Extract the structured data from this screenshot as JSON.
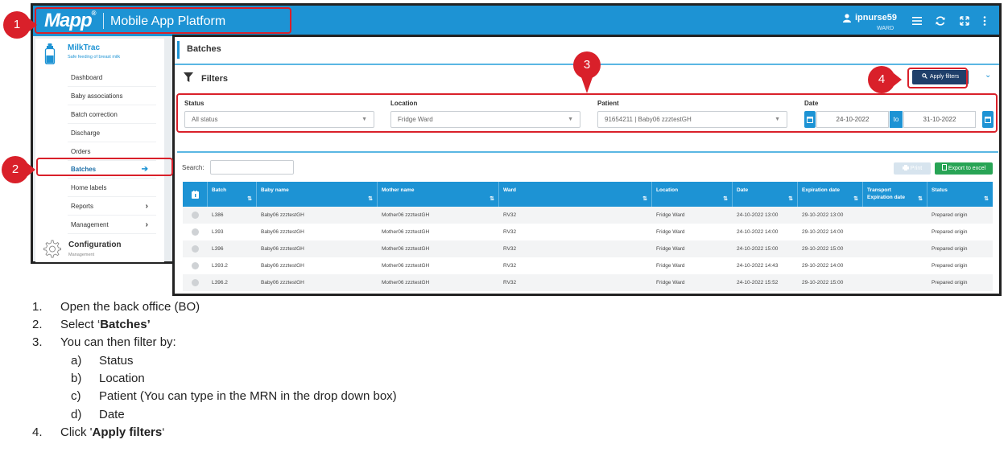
{
  "header": {
    "logo": "Mapp",
    "logo_mark": "®",
    "platform": "Mobile App Platform",
    "username": "ipnurse59",
    "user_ward": "WARD"
  },
  "sidebar": {
    "app_name": "MilkTrac",
    "app_subtitle": "Safe feeding of breast milk",
    "items": [
      {
        "label": "Dashboard"
      },
      {
        "label": "Baby associations"
      },
      {
        "label": "Batch correction"
      },
      {
        "label": "Discharge"
      },
      {
        "label": "Orders"
      },
      {
        "label": "Batches",
        "chevron": "➔"
      },
      {
        "label": "Home labels"
      },
      {
        "label": "Reports",
        "chevron": "›"
      },
      {
        "label": "Management",
        "chevron": "›"
      }
    ],
    "config_name": "Configuration",
    "config_subtitle": "Management"
  },
  "page": {
    "title": "Batches",
    "filters_title": "Filters",
    "apply_filters": "Apply filters",
    "collapse_icon": "⌄"
  },
  "filters": {
    "status": {
      "label": "Status",
      "value": "All status"
    },
    "location": {
      "label": "Location",
      "value": "Fridge Ward"
    },
    "patient": {
      "label": "Patient",
      "value": "91654211 | Baby06 zzztestGH"
    },
    "date": {
      "label": "Date",
      "from": "24-10-2022",
      "to_label": "to",
      "to": "31-10-2022"
    }
  },
  "table_tools": {
    "search_label": "Search:",
    "print": "Print",
    "export": "Export to excel"
  },
  "table": {
    "columns": [
      "Batch",
      "Baby name",
      "Mother name",
      "Ward",
      "Location",
      "Date",
      "Expiration date",
      "Transport Expiration date",
      "Status"
    ],
    "rows": [
      [
        "L386",
        "Baby06 zzztestGH",
        "Mother06 zzztestGH",
        "RV32",
        "Fridge Ward",
        "24-10-2022 13:00",
        "29-10-2022 13:00",
        "",
        "Prepared origin"
      ],
      [
        "L393",
        "Baby06 zzztestGH",
        "Mother06 zzztestGH",
        "RV32",
        "Fridge Ward",
        "24-10-2022 14:00",
        "29-10-2022 14:00",
        "",
        "Prepared origin"
      ],
      [
        "L396",
        "Baby06 zzztestGH",
        "Mother06 zzztestGH",
        "RV32",
        "Fridge Ward",
        "24-10-2022 15:00",
        "29-10-2022 15:00",
        "",
        "Prepared origin"
      ],
      [
        "L393.2",
        "Baby06 zzztestGH",
        "Mother06 zzztestGH",
        "RV32",
        "Fridge Ward",
        "24-10-2022 14:43",
        "29-10-2022 14:00",
        "",
        "Prepared origin"
      ],
      [
        "L396.2",
        "Baby06 zzztestGH",
        "Mother06 zzztestGH",
        "RV32",
        "Fridge Ward",
        "24-10-2022 15:52",
        "29-10-2022 15:00",
        "",
        "Prepared origin"
      ]
    ]
  },
  "callouts": [
    "1",
    "2",
    "3",
    "4"
  ],
  "instructions": [
    {
      "num": "1.",
      "text": "Open the back office (BO)"
    },
    {
      "num": "2.",
      "pre": "Select ‘",
      "bold": "Batches’",
      "post": ""
    },
    {
      "num": "3.",
      "text": "You can then filter by:"
    },
    {
      "num": "a)",
      "text": "Status",
      "sub": true
    },
    {
      "num": "b)",
      "text": "Location",
      "sub": true
    },
    {
      "num": "c)",
      "text": "Patient (You can type in the MRN in the drop down box)",
      "sub": true
    },
    {
      "num": "d)",
      "text": "Date",
      "sub": true
    },
    {
      "num": "4.",
      "pre": "Click '",
      "bold": "Apply filters",
      "post": "‘"
    }
  ]
}
